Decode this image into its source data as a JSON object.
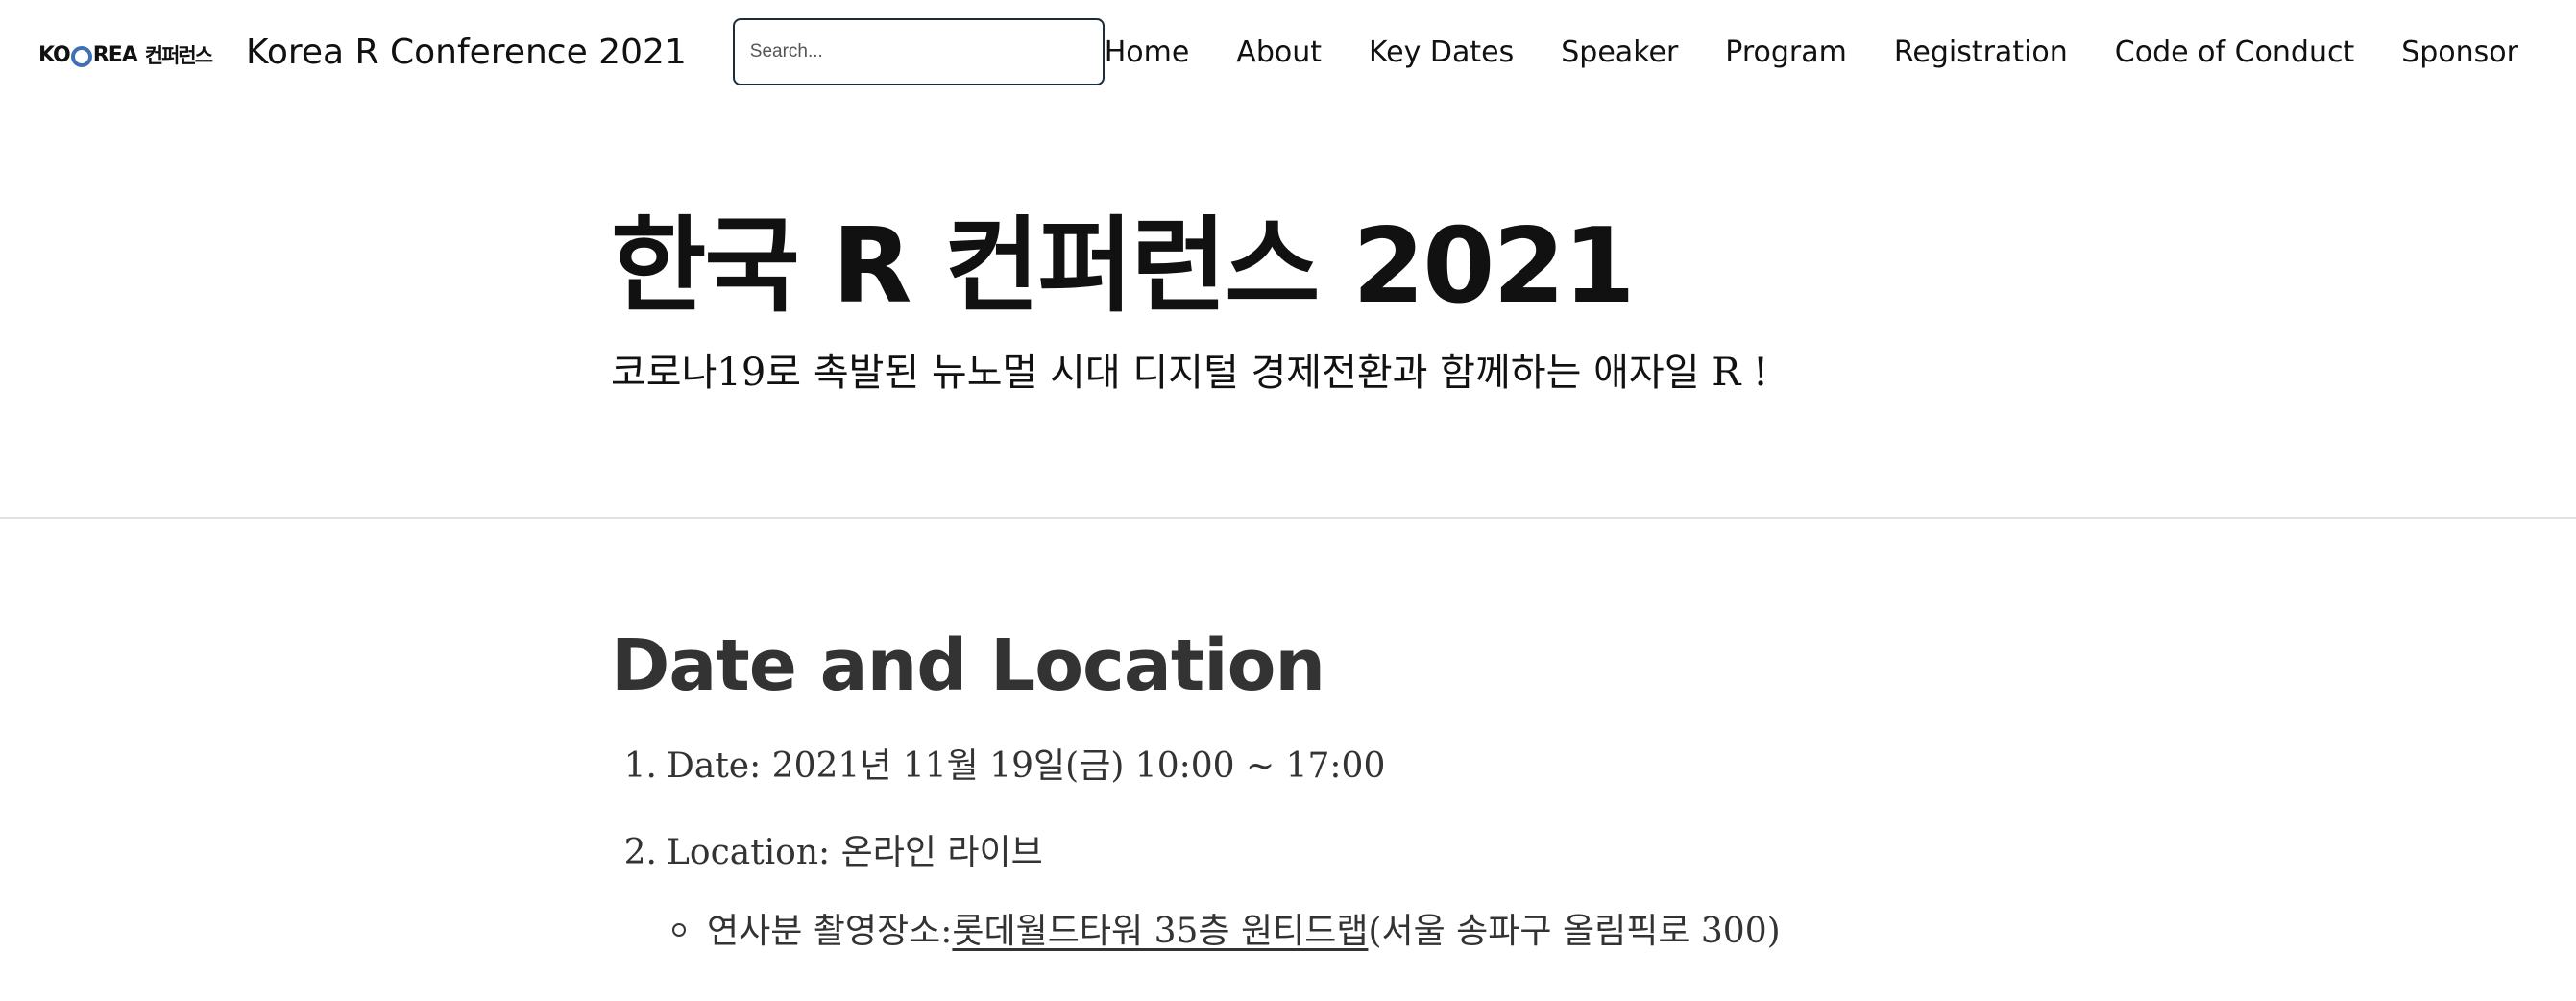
{
  "header": {
    "logo_text_left": "KO",
    "logo_text_right": "REA",
    "logo_text_korean": "컨퍼런스",
    "site_title": "Korea R Conference 2021",
    "search": {
      "placeholder": "Search..."
    },
    "nav": [
      {
        "label": "Home"
      },
      {
        "label": "About"
      },
      {
        "label": "Key Dates"
      },
      {
        "label": "Speaker"
      },
      {
        "label": "Program"
      },
      {
        "label": "Registration"
      },
      {
        "label": "Code of Conduct"
      },
      {
        "label": "Sponsor"
      }
    ]
  },
  "hero": {
    "title": "한국 R 컨퍼런스 2021",
    "subtitle": "코로나19로 촉발된 뉴노멀 시대 디지털 경제전환과 함께하는 애자일 R !"
  },
  "section": {
    "title": "Date and Location",
    "items": [
      {
        "num": "1.",
        "label": "Date: 2021년 11월 19일(금) 10:00 ~ 17:00"
      },
      {
        "num": "2.",
        "label": "Location: 온라인 라이브"
      }
    ],
    "sub_item": {
      "label": "연사분 촬영장소: ",
      "link": "롯데월드타워 35층 원티드랩",
      "suffix": " (서울 송파구 올림픽로 300)"
    }
  },
  "colors": {
    "logo_accent": "#3f6fb4",
    "search_border": "#1b2d3d",
    "divider": "#e2e2e2"
  }
}
